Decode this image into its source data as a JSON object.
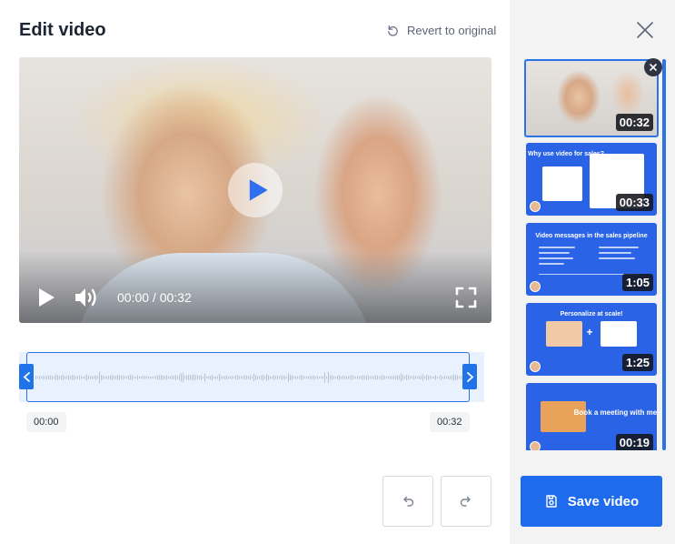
{
  "header": {
    "title": "Edit video",
    "revert_label": "Revert to original"
  },
  "player": {
    "timecode": "00:00 / 00:32"
  },
  "timeline": {
    "start_label": "00:00",
    "end_label": "00:32"
  },
  "sidebar": {
    "clips": [
      {
        "duration": "00:32",
        "selected": true
      },
      {
        "duration": "00:33",
        "heading": "Why use video for sales?"
      },
      {
        "duration": "1:05",
        "heading": "Video messages in the sales pipeline"
      },
      {
        "duration": "1:25",
        "heading": "Personalize at scale!"
      },
      {
        "duration": "00:19",
        "heading": "Book a meeting with me here"
      }
    ]
  },
  "actions": {
    "save_label": "Save video"
  },
  "colors": {
    "accent": "#1f6bee",
    "sidebar_bg": "#f3f3f4",
    "slide_bg": "#2b63e6"
  },
  "icons": [
    "revert-icon",
    "play-icon",
    "volume-icon",
    "fullscreen-icon",
    "close-icon",
    "undo-icon",
    "redo-icon",
    "save-icon",
    "remove-clip-icon"
  ]
}
